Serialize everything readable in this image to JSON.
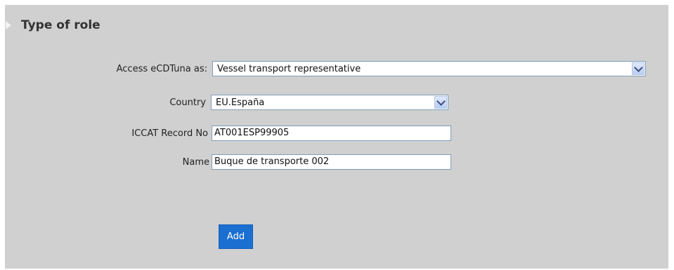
{
  "section": {
    "title": "Type of role",
    "icon": "triangle-right-icon"
  },
  "form": {
    "access": {
      "label": "Access eCDTuna as:",
      "value": "Vessel transport representative"
    },
    "country": {
      "label": "Country",
      "value": "EU.España"
    },
    "iccat": {
      "label": "ICCAT Record No",
      "value": "AT001ESP99905"
    },
    "name": {
      "label": "Name",
      "value": "Buque de transporte 002"
    }
  },
  "actions": {
    "add_label": "Add"
  },
  "colors": {
    "panel_bg": "#d0d0d0",
    "button_blue": "#1a6fd1"
  }
}
